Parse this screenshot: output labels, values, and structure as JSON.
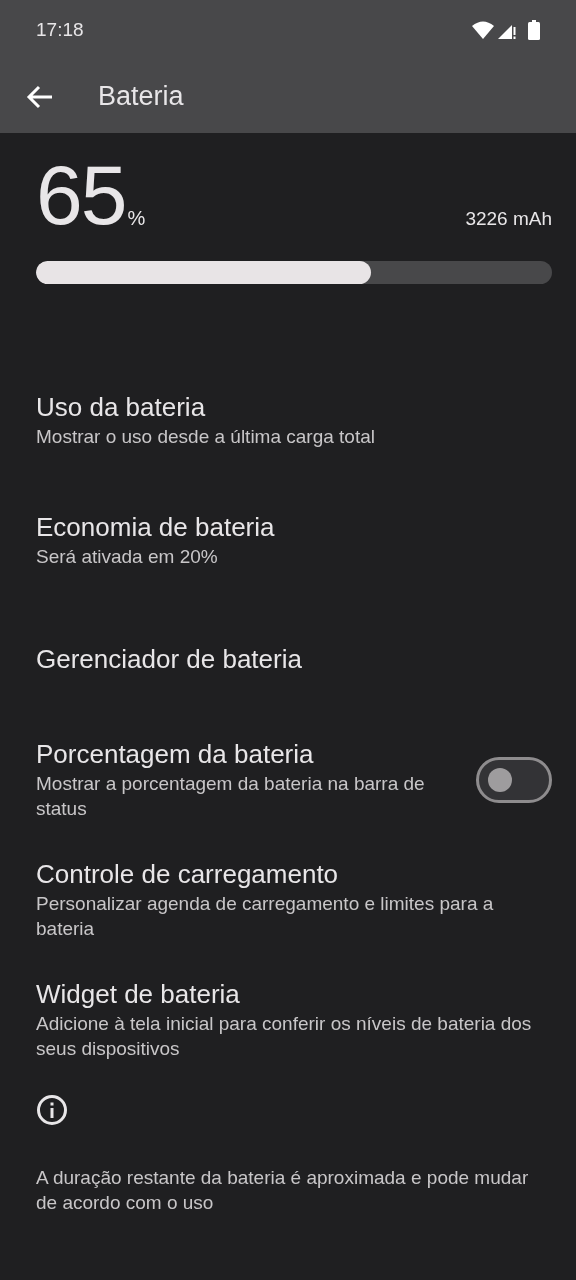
{
  "status_bar": {
    "time": "17:18"
  },
  "app_bar": {
    "title": "Bateria"
  },
  "battery": {
    "percent": "65",
    "unit": "%",
    "capacity": "3226 mAh",
    "level": 0.65
  },
  "items": [
    {
      "kind": "plain",
      "title": "Uso da bateria",
      "subtitle": "Mostrar o uso desde a última carga total"
    },
    {
      "kind": "plain",
      "title": "Economia de bateria",
      "subtitle": "Será ativada em 20%"
    },
    {
      "kind": "plain",
      "title": "Gerenciador de bateria"
    },
    {
      "kind": "toggle",
      "title": "Porcentagem da bateria",
      "subtitle": "Mostrar a porcentagem da bateria na barra de status",
      "on": false
    },
    {
      "kind": "plain",
      "title": "Controle de carregamento",
      "subtitle": "Personalizar agenda de carregamento e limites para a bateria"
    },
    {
      "kind": "plain",
      "title": "Widget de bateria",
      "subtitle": "Adicione à tela inicial para conferir os níveis de bateria dos seus dispositivos"
    }
  ],
  "footer": {
    "text": "A duração restante da bateria é aproximada e pode mudar de acordo com o uso"
  }
}
